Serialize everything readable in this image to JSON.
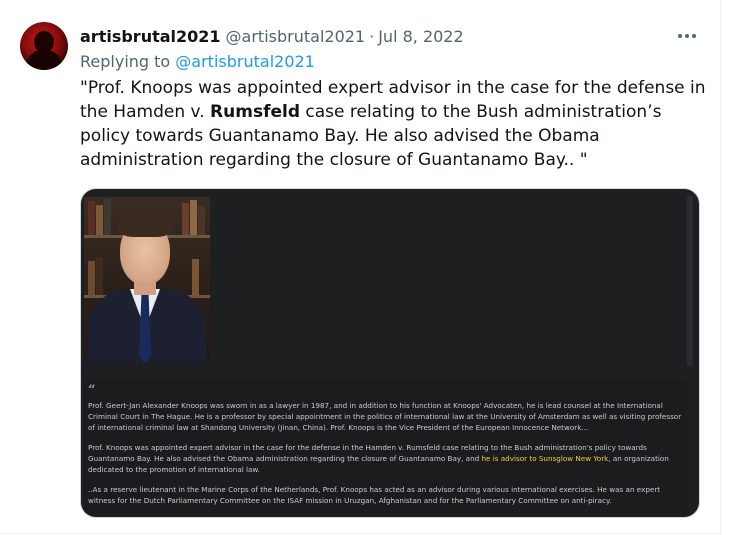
{
  "tweet": {
    "display_name": "artisbrutal2021",
    "handle": "@artisbrutal2021",
    "separator": "·",
    "date": "Jul 8, 2022",
    "more_icon": "more-horizontal-icon",
    "reply_prefix": "Replying to",
    "reply_handle": "@artisbrutal2021",
    "text_before": "\"Prof. Knoops was appointed expert advisor in the case for the defense in the Hamden v. ",
    "text_bold": "Rumsfeld",
    "text_after": " case relating to the Bush administration’s policy towards Guantanamo Bay. He also advised the Obama administration regarding the closure of Guantanamo Bay.. \""
  },
  "media": {
    "quote_mark": "“",
    "para1": "Prof. Geert-Jan Alexander Knoops was sworn in as a lawyer in 1987, and in addition to his function at Knoops' Advocaten, he is lead counsel at the International Criminal Court in The Hague. He is a professor by special appointment in the politics of international law at the University of Amsterdam as well as visiting professor of international criminal law at Shandong University (Jinan, China). Prof. Knoops is the Vice President of the European Innocence Network...",
    "para2_before": "Prof. Knoops was appointed expert advisor in the case for the defense in the Hamden v. Rumsfeld case relating to the Bush administration's policy towards Guantanamo Bay. He also advised the Obama administration regarding the closure of Guantanamo Bay, and ",
    "para2_highlight": "he is advisor to Sunsglow New York",
    "para2_after": ", an organization dedicated to the promotion of international law.",
    "para3": "..As a reserve lieutenant in the Marine Corps of the Netherlands, Prof. Knoops has acted as an advisor during various international exercises. He was an expert witness for the Dutch Parliamentary Committee on the ISAF mission in Uruzgan, Afghanistan and for the Parliamentary Committee on anti-piracy.",
    "highlight_color": "#f2d13a"
  },
  "colors": {
    "link": "#1d9bf0",
    "muted": "#536471",
    "text": "#0f1419"
  }
}
